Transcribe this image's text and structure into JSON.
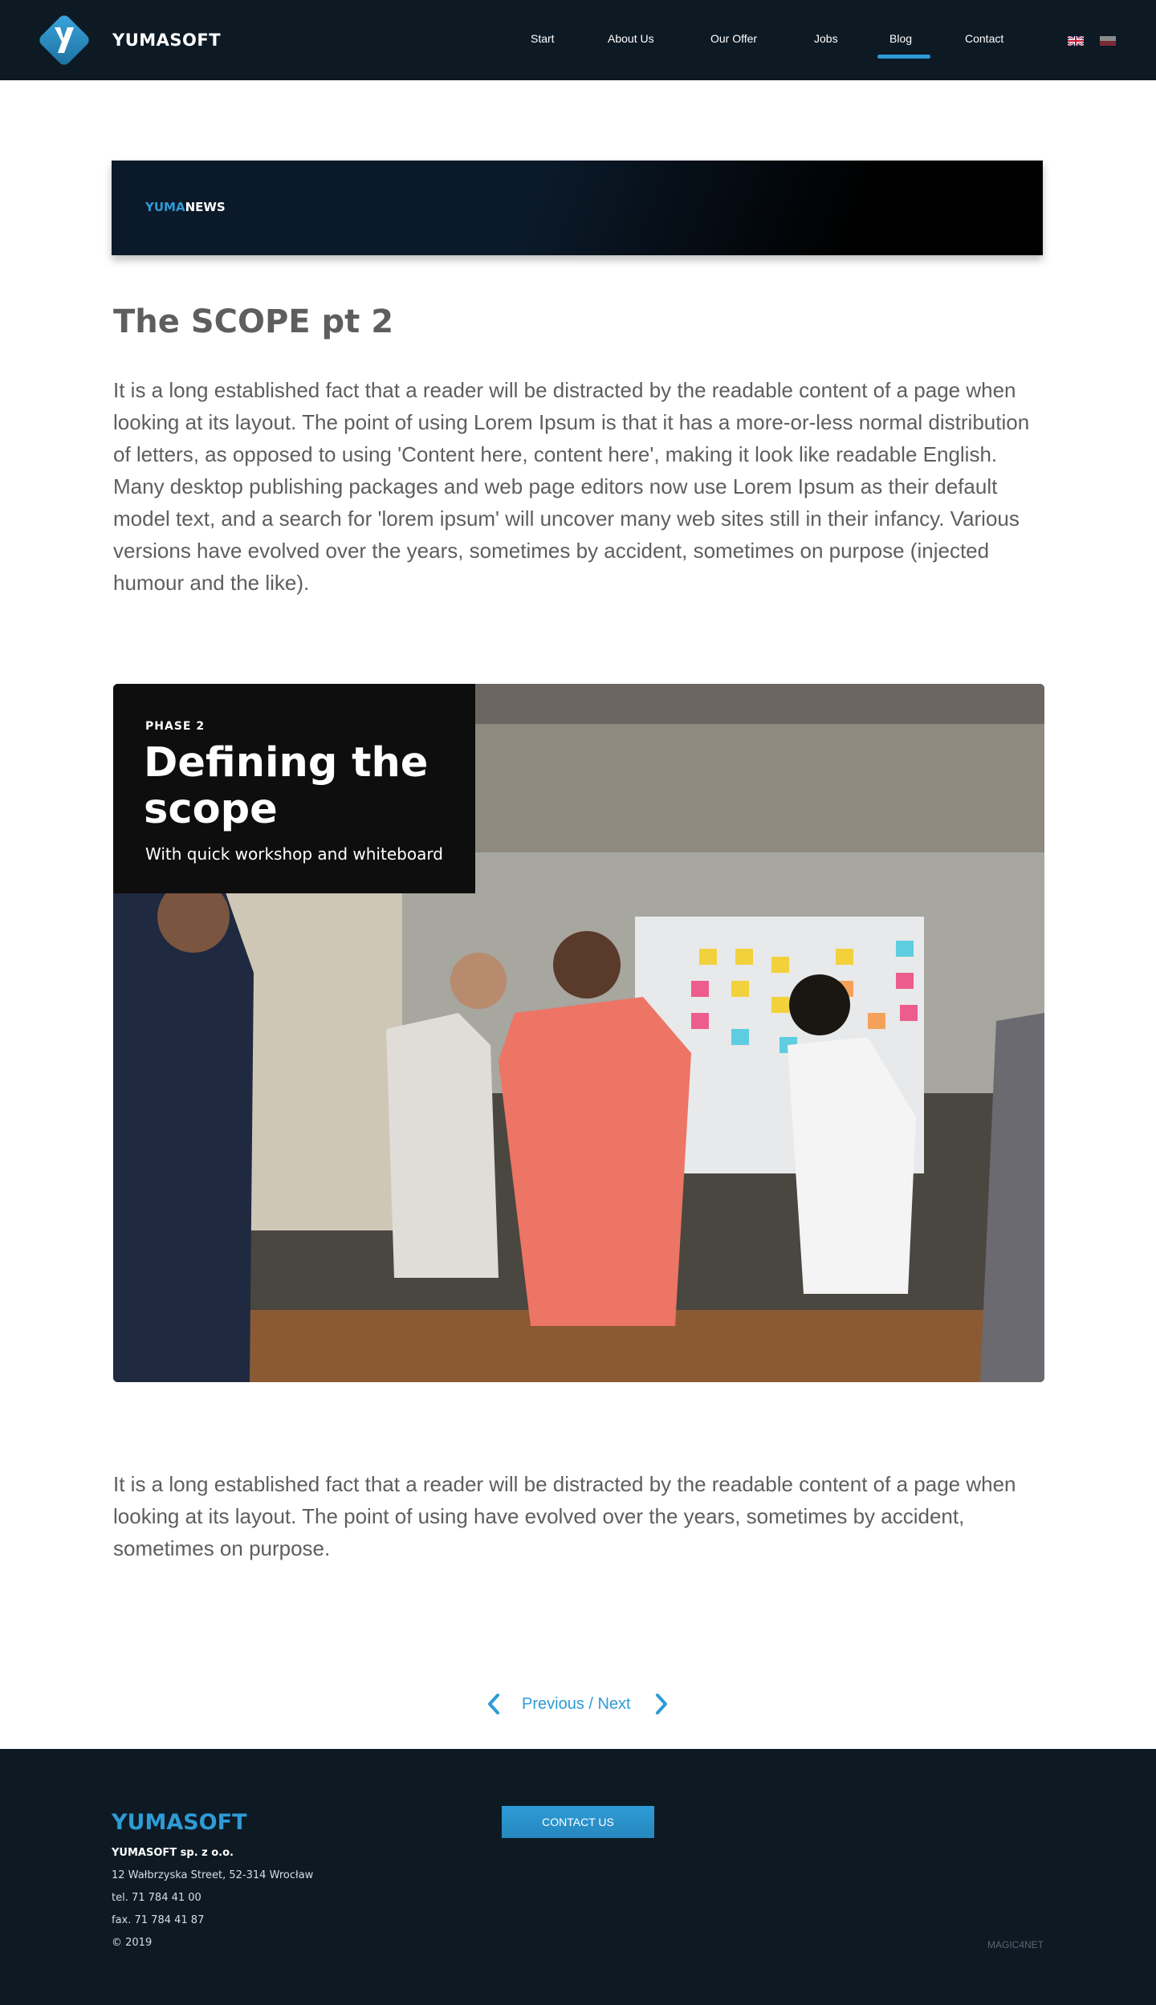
{
  "header": {
    "brand": "YUMASOFT",
    "nav": [
      {
        "label": "Start",
        "active": false
      },
      {
        "label": "About Us",
        "active": false
      },
      {
        "label": "Our Offer",
        "active": false
      },
      {
        "label": "Jobs",
        "active": false
      },
      {
        "label": "Blog",
        "active": true
      },
      {
        "label": "Contact",
        "active": false
      }
    ],
    "languages": [
      "english-flag-icon",
      "polish-flag-icon"
    ],
    "accent_color": "#2e9bd6"
  },
  "banner": {
    "label_part1": "YUMA",
    "label_part2": "NEWS"
  },
  "article": {
    "title": "The SCOPE pt 2",
    "paragraph1": "It is a long established fact that a reader will be distracted by the readable content of a page when looking at its layout. The point of using Lorem Ipsum is that it has a more-or-less normal distribution of letters, as opposed to using 'Content here, content here', making it look like readable English. Many desktop publishing packages and web page editors now use Lorem Ipsum as their default model text, and a search for 'lorem ipsum' will uncover many web sites still in their infancy. Various versions have evolved over the years, sometimes by accident, sometimes on purpose (injected humour and the like).",
    "image": {
      "phase": "PHASE 2",
      "heading": "Defining the scope",
      "subheading": "With quick workshop and whiteboard"
    },
    "paragraph2": "It is a long established fact that a reader will be distracted by the readable content of a page when looking at its layout. The point of using  have evolved over the years, sometimes by accident, sometimes on purpose."
  },
  "pagination": {
    "label": "Previous / Next"
  },
  "footer": {
    "brand": "YUMASOFT",
    "company": "YUMASOFT sp. z o.o.",
    "address": "12 Wałbrzyska Street, 52-314 Wrocław",
    "tel": "tel. 71 784 41 00",
    "fax": "fax. 71 784 41 87",
    "copyright": "© 2019",
    "contact_button": "CONTACT US",
    "credit": "MAGIC4NET"
  }
}
